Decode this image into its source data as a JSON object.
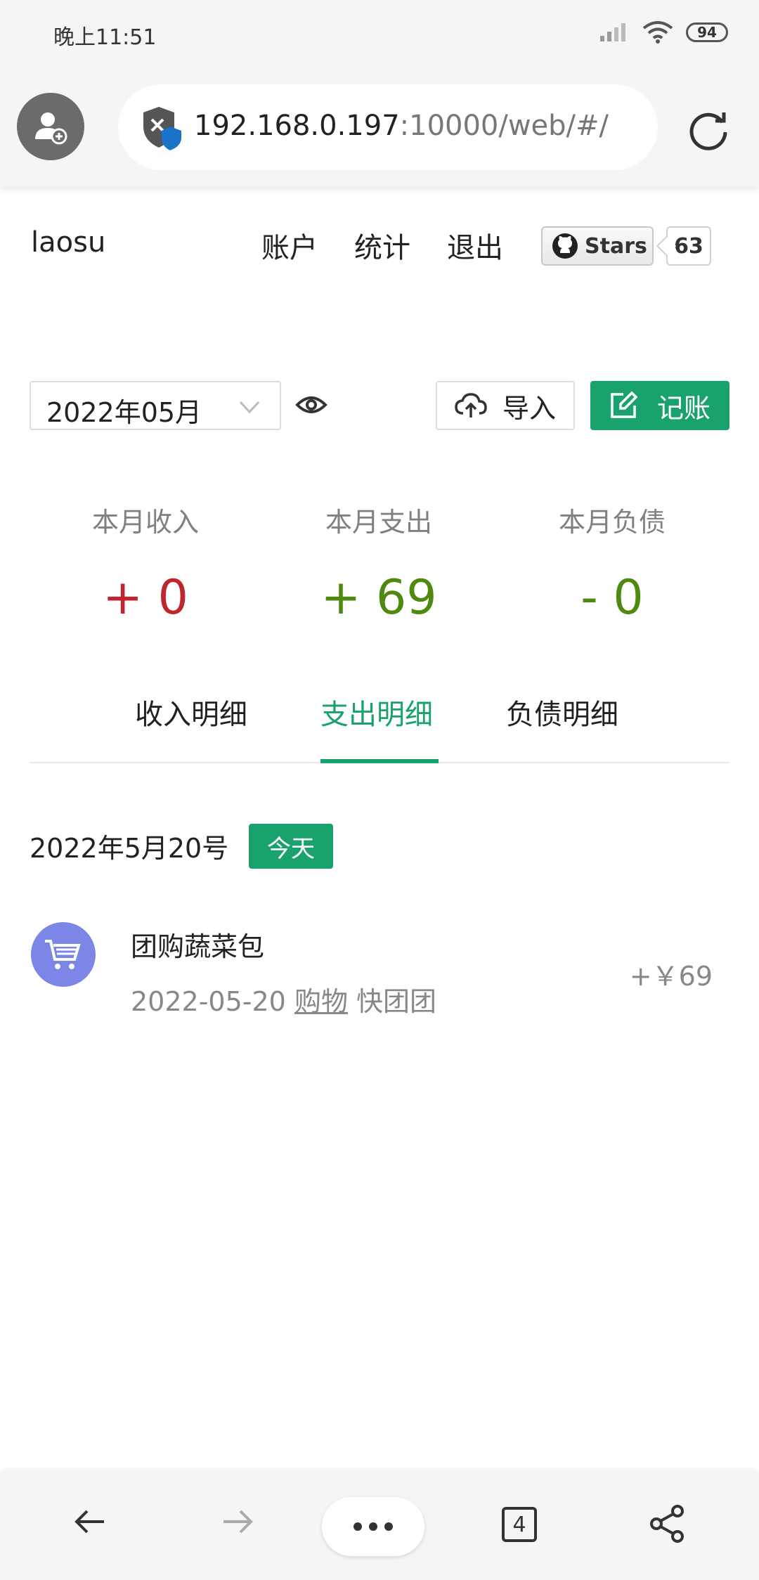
{
  "status_bar": {
    "time": "晚上11:51",
    "battery": "94"
  },
  "browser": {
    "url_host": "192.168.0.197",
    "url_rest": ":10000/web/#/",
    "tab_count": "4"
  },
  "header": {
    "site_name": "laosu",
    "nav": [
      "账户",
      "统计",
      "退出"
    ],
    "github_label": "Stars",
    "github_count": "63"
  },
  "toolbar": {
    "month": "2022年05月",
    "import_label": "导入",
    "record_label": "记账"
  },
  "stats": [
    {
      "label": "本月收入",
      "value": "+ 0",
      "color": "#c0262f"
    },
    {
      "label": "本月支出",
      "value": "+ 69",
      "color": "#4f8a10"
    },
    {
      "label": "本月负债",
      "value": "- 0",
      "color": "#4f8a10"
    }
  ],
  "tabs": [
    {
      "label": "收入明细",
      "active": false
    },
    {
      "label": "支出明细",
      "active": true
    },
    {
      "label": "负债明细",
      "active": false
    }
  ],
  "records": {
    "date_heading": "2022年5月20号",
    "today_tag": "今天",
    "items": [
      {
        "title": "团购蔬菜包",
        "date": "2022-05-20",
        "category": "购物",
        "note": "快团团",
        "amount": "+￥69",
        "icon": "shopping-cart-icon"
      }
    ]
  },
  "colors": {
    "accent": "#1aa26c",
    "avatar": "#7b86e6"
  }
}
